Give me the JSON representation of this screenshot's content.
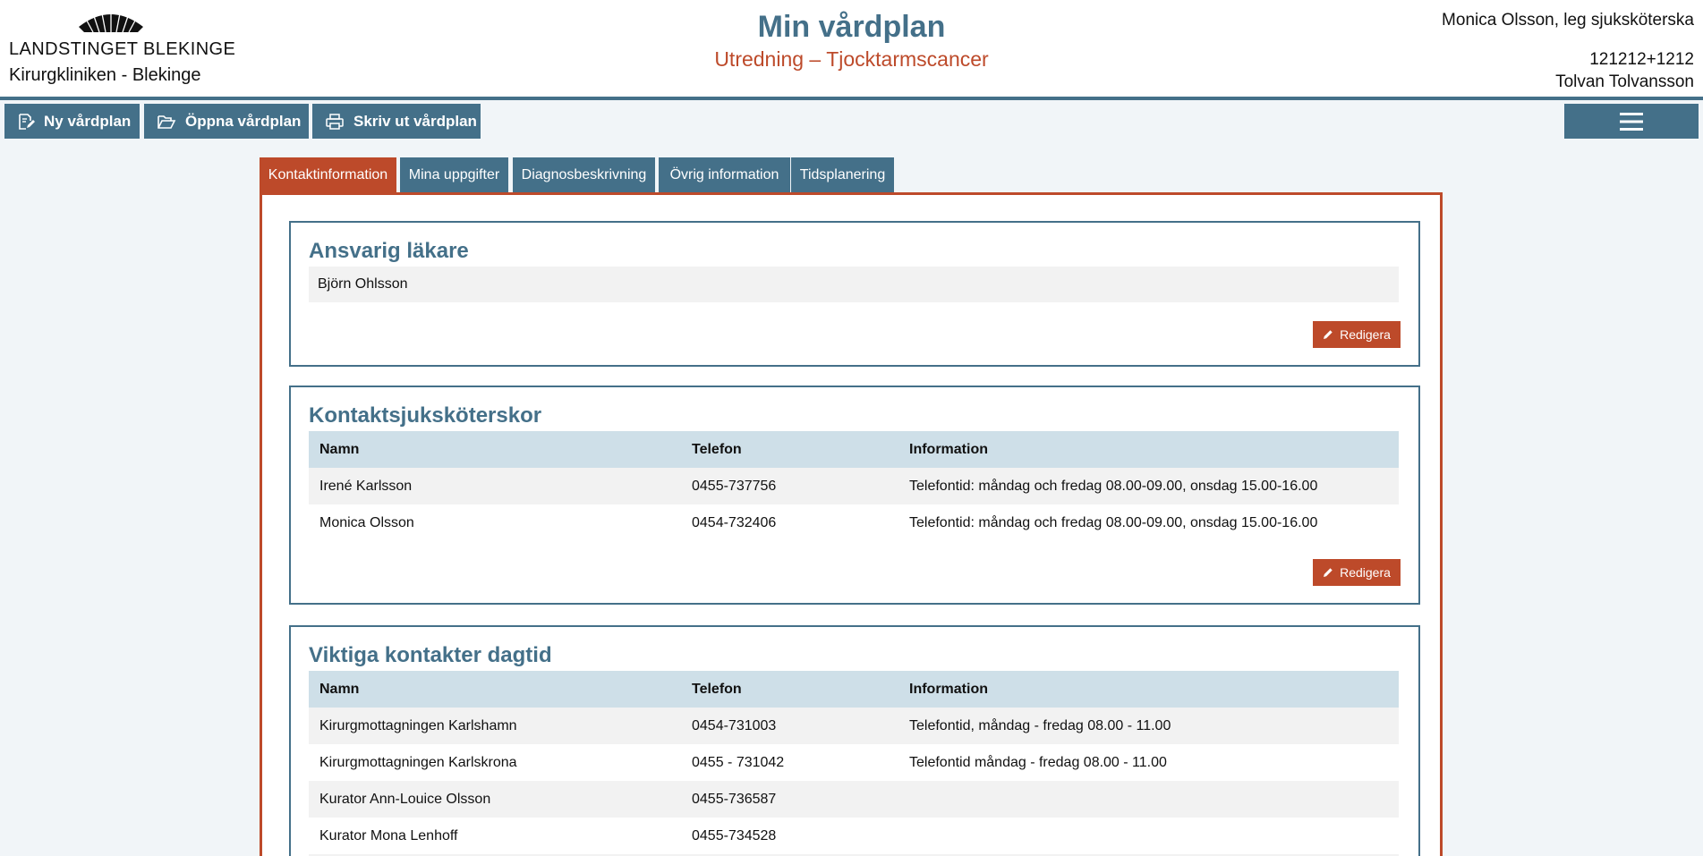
{
  "header": {
    "org_name": "LANDSTINGET BLEKINGE",
    "clinic": "Kirurgkliniken - Blekinge",
    "title": "Min vårdplan",
    "subtitle": "Utredning – Tjocktarmscancer",
    "user": "Monica Olsson, leg sjuksköterska",
    "patient_id": "121212+1212",
    "patient_name": "Tolvan Tolvansson"
  },
  "toolbar": {
    "new_plan": "Ny vårdplan",
    "open_plan": "Öppna vårdplan",
    "print_plan": "Skriv ut vårdplan"
  },
  "tabs": [
    {
      "label": "Kontaktinformation",
      "active": true
    },
    {
      "label": "Mina uppgifter",
      "active": false
    },
    {
      "label": "Diagnosbeskrivning",
      "active": false
    },
    {
      "label": "Övrig information",
      "active": false
    },
    {
      "label": "Tidsplanering",
      "active": false
    }
  ],
  "sections": {
    "doctor": {
      "title": "Ansvarig läkare",
      "value": "Björn Ohlsson",
      "edit_label": "Redigera"
    },
    "nurses": {
      "title": "Kontaktsjuksköterskor",
      "columns": [
        "Namn",
        "Telefon",
        "Information"
      ],
      "rows": [
        [
          "Irené Karlsson",
          "0455-737756",
          "Telefontid: måndag och fredag 08.00-09.00, onsdag 15.00-16.00"
        ],
        [
          "Monica Olsson",
          "0454-732406",
          "Telefontid: måndag och fredag 08.00-09.00, onsdag 15.00-16.00"
        ]
      ],
      "edit_label": "Redigera"
    },
    "contacts": {
      "title": "Viktiga kontakter dagtid",
      "columns": [
        "Namn",
        "Telefon",
        "Information"
      ],
      "rows": [
        [
          "Kirurgmottagningen Karlshamn",
          "0454-731003",
          "Telefontid, måndag - fredag 08.00 - 11.00"
        ],
        [
          "Kirurgmottagningen Karlskrona",
          "0455 - 731042",
          "Telefontid måndag - fredag 08.00 - 11.00"
        ],
        [
          "Kurator Ann-Louice Olsson",
          "0455-736587",
          ""
        ],
        [
          "Kurator Mona Lenhoff",
          "0455-734528",
          ""
        ]
      ]
    }
  },
  "colors": {
    "primary": "#447089",
    "accent": "#bd4a2a",
    "table_header": "#cedfe8",
    "row_alt": "#f2f2f2",
    "page_bg": "#f1f5f8"
  },
  "icons": {
    "logo": "crown-logo",
    "new_plan": "edit-document-icon",
    "open_plan": "open-folder-icon",
    "print_plan": "printer-icon",
    "menu": "hamburger-icon",
    "edit": "pencil-icon"
  }
}
